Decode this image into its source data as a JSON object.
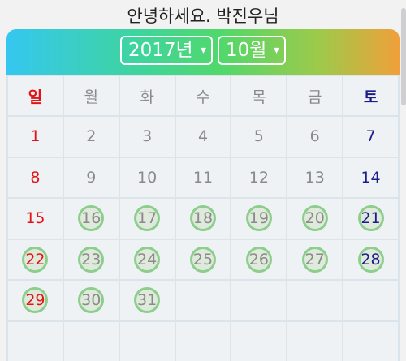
{
  "greeting": "안녕하세요. 박진우님",
  "header": {
    "year": "2017년",
    "month": "10월",
    "caret": "▾"
  },
  "weekdays": [
    "일",
    "월",
    "화",
    "수",
    "목",
    "금",
    "토"
  ],
  "weeks": [
    [
      "1",
      "2",
      "3",
      "4",
      "5",
      "6",
      "7"
    ],
    [
      "8",
      "9",
      "10",
      "11",
      "12",
      "13",
      "14"
    ],
    [
      "15",
      "16",
      "17",
      "18",
      "19",
      "20",
      "21"
    ],
    [
      "22",
      "23",
      "24",
      "25",
      "26",
      "27",
      "28"
    ],
    [
      "29",
      "30",
      "31",
      "",
      "",
      "",
      ""
    ],
    [
      "",
      "",
      "",
      "",
      "",
      "",
      ""
    ]
  ],
  "marked_days": [
    "16",
    "17",
    "18",
    "19",
    "20",
    "21",
    "22",
    "23",
    "24",
    "25",
    "26",
    "27",
    "28",
    "29",
    "30",
    "31"
  ],
  "colors": {
    "sunday": "#e31414",
    "saturday": "#1c1c8c",
    "weekday": "#8a8a8a",
    "mark_ring": "#8ccf8c"
  }
}
